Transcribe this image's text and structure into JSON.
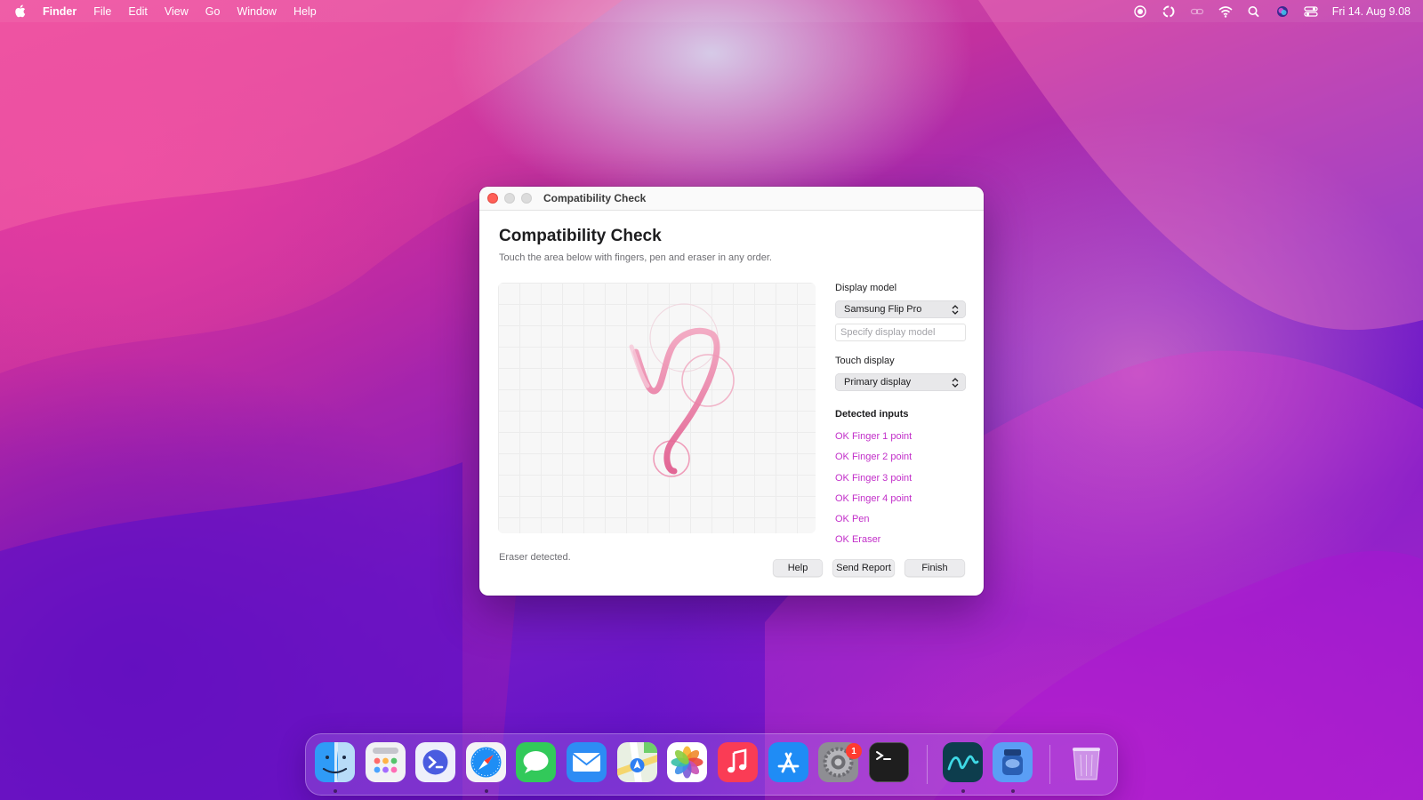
{
  "menubar": {
    "app_name": "Finder",
    "items": [
      "File",
      "Edit",
      "View",
      "Go",
      "Window",
      "Help"
    ],
    "clock": "Fri 14. Aug  9.08",
    "status_icons": [
      "screen-record-icon",
      "sync-icon",
      "link-icon",
      "wifi-icon",
      "spotlight-search-icon",
      "siri-icon",
      "control-center-icon"
    ]
  },
  "window": {
    "title": "Compatibility Check",
    "heading": "Compatibility Check",
    "subtitle": "Touch the area below with fingers, pen and eraser in any order.",
    "display_model": {
      "label": "Display model",
      "selected": "Samsung Flip Pro",
      "placeholder": "Specify display model",
      "value": ""
    },
    "touch_display": {
      "label": "Touch display",
      "selected": "Primary display"
    },
    "detected_inputs": {
      "label": "Detected inputs",
      "items": [
        "OK Finger 1 point",
        "OK Finger 2 point",
        "OK Finger 3 point",
        "OK Finger 4 point",
        "OK Pen",
        "OK Eraser"
      ]
    },
    "status": "Eraser detected.",
    "buttons": {
      "help": "Help",
      "send_report": "Send Report",
      "finish": "Finish"
    },
    "accent_color": "#c22fc9"
  },
  "dock": {
    "apps": [
      "finder-icon",
      "launchpad-icon",
      "remote-desktop-icon",
      "safari-icon",
      "messages-icon",
      "mail-icon",
      "maps-icon",
      "photos-icon",
      "music-icon",
      "app-store-icon",
      "system-settings-icon",
      "terminal-icon",
      "pen-driver-icon",
      "ink-app-icon",
      "trash-icon"
    ],
    "system_settings_badge": "1"
  }
}
